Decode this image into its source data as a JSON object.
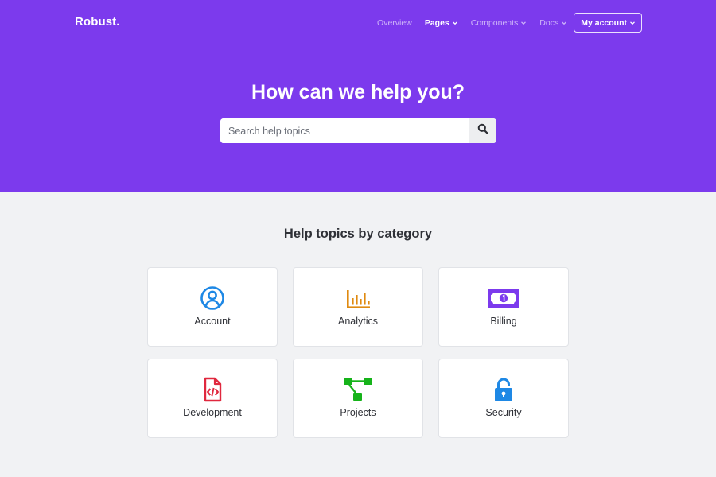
{
  "brand": "Robust.",
  "nav": {
    "items": [
      {
        "label": "Overview",
        "dropdown": false,
        "active": false
      },
      {
        "label": "Pages",
        "dropdown": true,
        "active": true
      },
      {
        "label": "Components",
        "dropdown": true,
        "active": false
      },
      {
        "label": "Docs",
        "dropdown": true,
        "active": false
      }
    ],
    "account_label": "My account"
  },
  "hero": {
    "title": "How can we help you?",
    "search_placeholder": "Search help topics"
  },
  "section_title": "Help topics by category",
  "categories": [
    {
      "label": "Account",
      "icon": "user-circle-icon",
      "color": "#1e88e5"
    },
    {
      "label": "Analytics",
      "icon": "bar-chart-icon",
      "color": "#e08a10"
    },
    {
      "label": "Billing",
      "icon": "banknote-icon",
      "color": "#7c3aed"
    },
    {
      "label": "Development",
      "icon": "code-file-icon",
      "color": "#e0283e"
    },
    {
      "label": "Projects",
      "icon": "flow-chart-icon",
      "color": "#16b31a"
    },
    {
      "label": "Security",
      "icon": "unlock-icon",
      "color": "#1e88e5"
    }
  ],
  "colors": {
    "hero_bg": "#7c3aed",
    "page_bg": "#f1f2f4"
  }
}
